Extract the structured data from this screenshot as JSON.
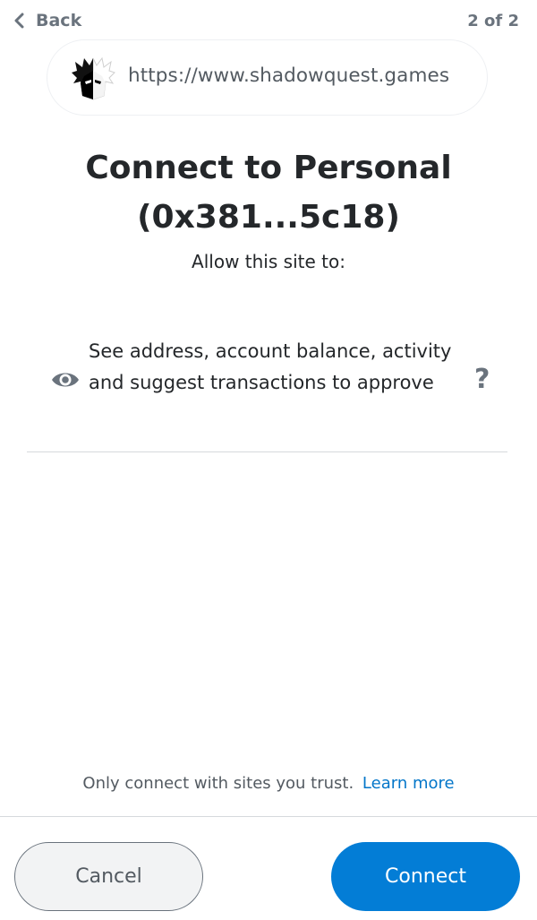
{
  "header": {
    "back_label": "Back",
    "step": "2 of 2",
    "back_icon": "chevron-left-icon"
  },
  "site": {
    "url": "https://www.shadowquest.games",
    "favicon": "shadowquest-favicon"
  },
  "title": {
    "line1": "Connect to Personal",
    "line2": "(0x381...5c18)"
  },
  "subtitle": "Allow this site to:",
  "permission": {
    "icon": "eye-icon",
    "text": "See address, account balance, activity and suggest transactions to approve",
    "help_icon": "question-icon",
    "help_glyph": "?"
  },
  "footer": {
    "trust_text": "Only connect with sites you trust.",
    "learn_more": "Learn more",
    "cancel_label": "Cancel",
    "connect_label": "Connect"
  },
  "colors": {
    "primary": "#037dd6",
    "link": "#0376c9",
    "text": "#24272a",
    "muted": "#6a737d"
  }
}
